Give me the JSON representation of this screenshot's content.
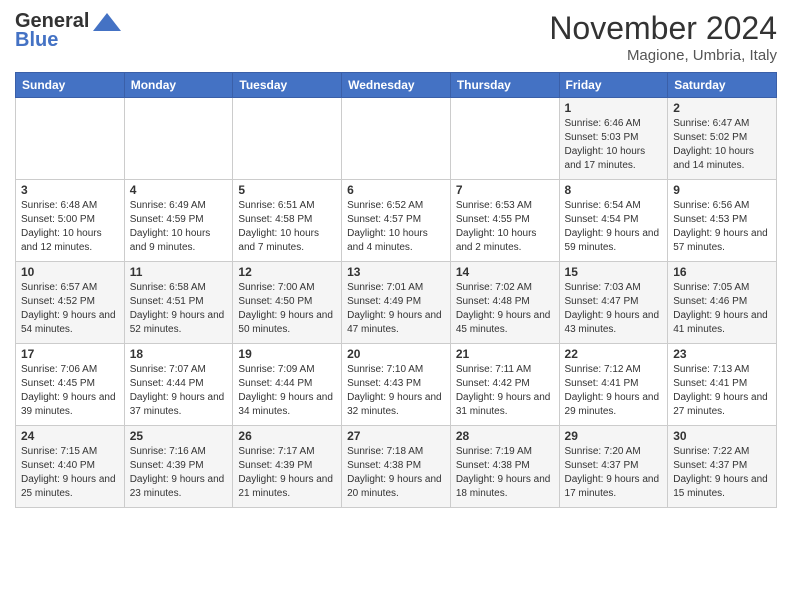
{
  "header": {
    "logo_general": "General",
    "logo_blue": "Blue",
    "month_title": "November 2024",
    "subtitle": "Magione, Umbria, Italy"
  },
  "days_of_week": [
    "Sunday",
    "Monday",
    "Tuesday",
    "Wednesday",
    "Thursday",
    "Friday",
    "Saturday"
  ],
  "weeks": [
    [
      {
        "day": "",
        "info": ""
      },
      {
        "day": "",
        "info": ""
      },
      {
        "day": "",
        "info": ""
      },
      {
        "day": "",
        "info": ""
      },
      {
        "day": "",
        "info": ""
      },
      {
        "day": "1",
        "info": "Sunrise: 6:46 AM\nSunset: 5:03 PM\nDaylight: 10 hours and 17 minutes."
      },
      {
        "day": "2",
        "info": "Sunrise: 6:47 AM\nSunset: 5:02 PM\nDaylight: 10 hours and 14 minutes."
      }
    ],
    [
      {
        "day": "3",
        "info": "Sunrise: 6:48 AM\nSunset: 5:00 PM\nDaylight: 10 hours and 12 minutes."
      },
      {
        "day": "4",
        "info": "Sunrise: 6:49 AM\nSunset: 4:59 PM\nDaylight: 10 hours and 9 minutes."
      },
      {
        "day": "5",
        "info": "Sunrise: 6:51 AM\nSunset: 4:58 PM\nDaylight: 10 hours and 7 minutes."
      },
      {
        "day": "6",
        "info": "Sunrise: 6:52 AM\nSunset: 4:57 PM\nDaylight: 10 hours and 4 minutes."
      },
      {
        "day": "7",
        "info": "Sunrise: 6:53 AM\nSunset: 4:55 PM\nDaylight: 10 hours and 2 minutes."
      },
      {
        "day": "8",
        "info": "Sunrise: 6:54 AM\nSunset: 4:54 PM\nDaylight: 9 hours and 59 minutes."
      },
      {
        "day": "9",
        "info": "Sunrise: 6:56 AM\nSunset: 4:53 PM\nDaylight: 9 hours and 57 minutes."
      }
    ],
    [
      {
        "day": "10",
        "info": "Sunrise: 6:57 AM\nSunset: 4:52 PM\nDaylight: 9 hours and 54 minutes."
      },
      {
        "day": "11",
        "info": "Sunrise: 6:58 AM\nSunset: 4:51 PM\nDaylight: 9 hours and 52 minutes."
      },
      {
        "day": "12",
        "info": "Sunrise: 7:00 AM\nSunset: 4:50 PM\nDaylight: 9 hours and 50 minutes."
      },
      {
        "day": "13",
        "info": "Sunrise: 7:01 AM\nSunset: 4:49 PM\nDaylight: 9 hours and 47 minutes."
      },
      {
        "day": "14",
        "info": "Sunrise: 7:02 AM\nSunset: 4:48 PM\nDaylight: 9 hours and 45 minutes."
      },
      {
        "day": "15",
        "info": "Sunrise: 7:03 AM\nSunset: 4:47 PM\nDaylight: 9 hours and 43 minutes."
      },
      {
        "day": "16",
        "info": "Sunrise: 7:05 AM\nSunset: 4:46 PM\nDaylight: 9 hours and 41 minutes."
      }
    ],
    [
      {
        "day": "17",
        "info": "Sunrise: 7:06 AM\nSunset: 4:45 PM\nDaylight: 9 hours and 39 minutes."
      },
      {
        "day": "18",
        "info": "Sunrise: 7:07 AM\nSunset: 4:44 PM\nDaylight: 9 hours and 37 minutes."
      },
      {
        "day": "19",
        "info": "Sunrise: 7:09 AM\nSunset: 4:44 PM\nDaylight: 9 hours and 34 minutes."
      },
      {
        "day": "20",
        "info": "Sunrise: 7:10 AM\nSunset: 4:43 PM\nDaylight: 9 hours and 32 minutes."
      },
      {
        "day": "21",
        "info": "Sunrise: 7:11 AM\nSunset: 4:42 PM\nDaylight: 9 hours and 31 minutes."
      },
      {
        "day": "22",
        "info": "Sunrise: 7:12 AM\nSunset: 4:41 PM\nDaylight: 9 hours and 29 minutes."
      },
      {
        "day": "23",
        "info": "Sunrise: 7:13 AM\nSunset: 4:41 PM\nDaylight: 9 hours and 27 minutes."
      }
    ],
    [
      {
        "day": "24",
        "info": "Sunrise: 7:15 AM\nSunset: 4:40 PM\nDaylight: 9 hours and 25 minutes."
      },
      {
        "day": "25",
        "info": "Sunrise: 7:16 AM\nSunset: 4:39 PM\nDaylight: 9 hours and 23 minutes."
      },
      {
        "day": "26",
        "info": "Sunrise: 7:17 AM\nSunset: 4:39 PM\nDaylight: 9 hours and 21 minutes."
      },
      {
        "day": "27",
        "info": "Sunrise: 7:18 AM\nSunset: 4:38 PM\nDaylight: 9 hours and 20 minutes."
      },
      {
        "day": "28",
        "info": "Sunrise: 7:19 AM\nSunset: 4:38 PM\nDaylight: 9 hours and 18 minutes."
      },
      {
        "day": "29",
        "info": "Sunrise: 7:20 AM\nSunset: 4:37 PM\nDaylight: 9 hours and 17 minutes."
      },
      {
        "day": "30",
        "info": "Sunrise: 7:22 AM\nSunset: 4:37 PM\nDaylight: 9 hours and 15 minutes."
      }
    ]
  ]
}
